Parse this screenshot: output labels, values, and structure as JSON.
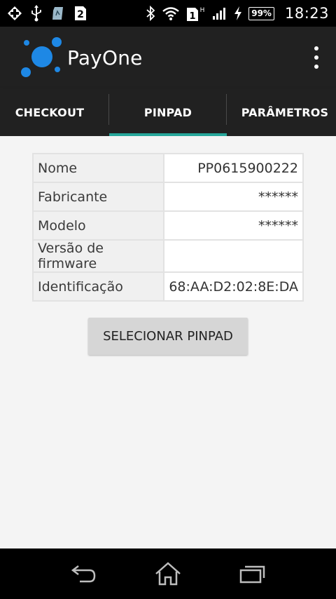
{
  "status_bar": {
    "notification_sim": "2",
    "sim_slot": "1",
    "network_type": "H",
    "battery": "99%",
    "time": "18:23",
    "icons": [
      "health-plus-icon",
      "usb-icon",
      "sd-card-icon",
      "sim-2-icon",
      "bluetooth-icon",
      "wifi-icon",
      "sim-1-icon",
      "signal-icon",
      "charging-icon",
      "battery-icon"
    ]
  },
  "app_bar": {
    "title": "PayOne",
    "logo_color": "#1e88e5",
    "menu_icon": "overflow-menu-icon"
  },
  "tabs": [
    {
      "label": "CHECKOUT",
      "selected": false
    },
    {
      "label": "PINPAD",
      "selected": true
    },
    {
      "label": "PARÂMETROS",
      "selected": false
    }
  ],
  "accent_color": "#26a69a",
  "pinpad_info": {
    "rows": [
      {
        "label": "Nome",
        "value": "PP0615900222"
      },
      {
        "label": "Fabricante",
        "value": "******"
      },
      {
        "label": "Modelo",
        "value": "******"
      },
      {
        "label": "Versão de firmware",
        "value": ""
      },
      {
        "label": "Identificação",
        "value": "68:AA:D2:02:8E:DA"
      }
    ]
  },
  "actions": {
    "select_pinpad_label": "SELECIONAR PINPAD"
  },
  "nav_bar": {
    "icons": [
      "back-icon",
      "home-icon",
      "recents-icon"
    ]
  }
}
